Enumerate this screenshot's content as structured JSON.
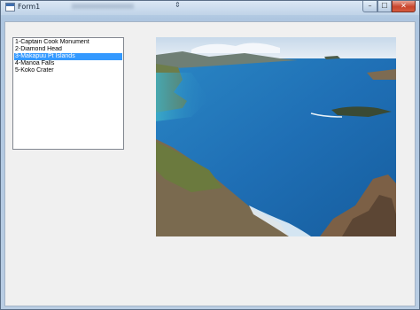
{
  "window": {
    "title": "Form1",
    "controls": {
      "minimize": "–",
      "maximize": "☐",
      "close": "✕"
    }
  },
  "listbox": {
    "items": [
      "1-Captain Cook Monument",
      "2-Diamond Head",
      "3-Makapuu Pt Islands",
      "4-Manoa Falls",
      "5-Koko Crater"
    ],
    "selected_index": 2
  },
  "picture": {
    "subject": "coastal view of ocean and islands from cliff",
    "colors": {
      "sea": "#1f6fb5",
      "sky": "#dfe9f3",
      "rock": "#7a6a4f"
    }
  },
  "icons": [
    "app-icon",
    "minimize-icon",
    "maximize-icon",
    "close-icon"
  ]
}
